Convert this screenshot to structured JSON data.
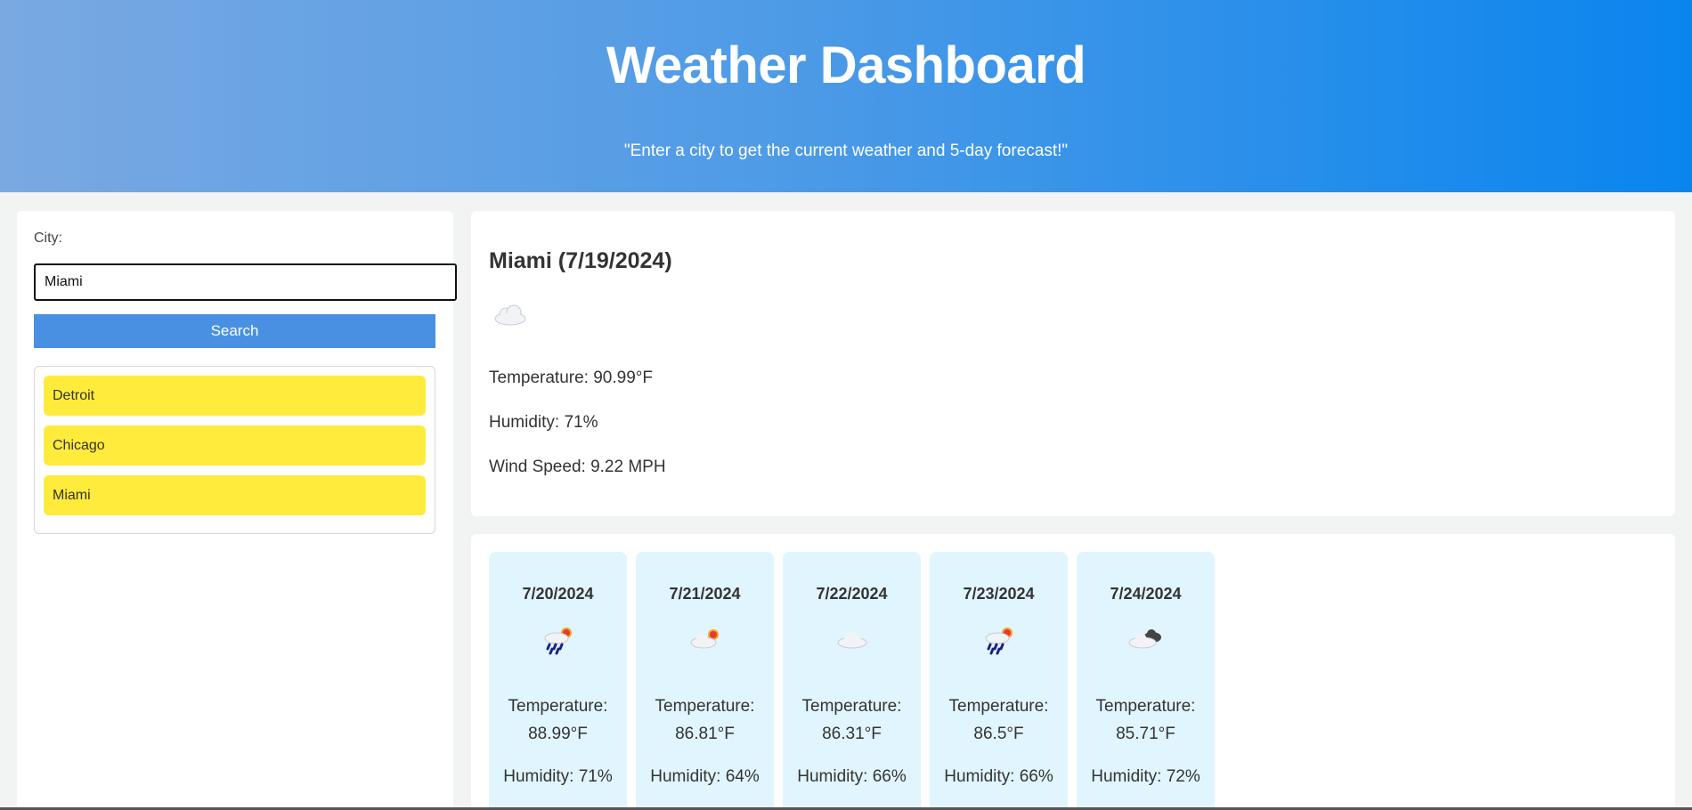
{
  "header": {
    "title": "Weather Dashboard",
    "subtitle": "\"Enter a city to get the current weather and 5-day forecast!\""
  },
  "search": {
    "label": "City:",
    "value": "Miami",
    "button_label": "Search"
  },
  "history": [
    "Detroit",
    "Chicago",
    "Miami"
  ],
  "current": {
    "heading": "Miami (7/19/2024)",
    "icon": "cloud-icon",
    "temperature": "Temperature: 90.99°F",
    "humidity": "Humidity: 71%",
    "wind": "Wind Speed: 9.22 MPH"
  },
  "forecast": [
    {
      "date": "7/20/2024",
      "icon": "rain-sun-icon",
      "temp_label": "Temperature:",
      "temp_value": "88.99°F",
      "humidity": "Humidity: 71%"
    },
    {
      "date": "7/21/2024",
      "icon": "partly-cloudy-icon",
      "temp_label": "Temperature:",
      "temp_value": "86.81°F",
      "humidity": "Humidity: 64%"
    },
    {
      "date": "7/22/2024",
      "icon": "cloud-icon",
      "temp_label": "Temperature:",
      "temp_value": "86.31°F",
      "humidity": "Humidity: 66%"
    },
    {
      "date": "7/23/2024",
      "icon": "rain-sun-icon",
      "temp_label": "Temperature:",
      "temp_value": "86.5°F",
      "humidity": "Humidity: 66%"
    },
    {
      "date": "7/24/2024",
      "icon": "dark-clouds-icon",
      "temp_label": "Temperature:",
      "temp_value": "85.71°F",
      "humidity": "Humidity: 72%"
    }
  ],
  "colors": {
    "header_gradient_start": "#7aa9e2",
    "header_gradient_end": "#0a85ee",
    "search_button": "#4a90e2",
    "history_item": "#ffeb3b",
    "forecast_card": "#e1f5fe"
  }
}
